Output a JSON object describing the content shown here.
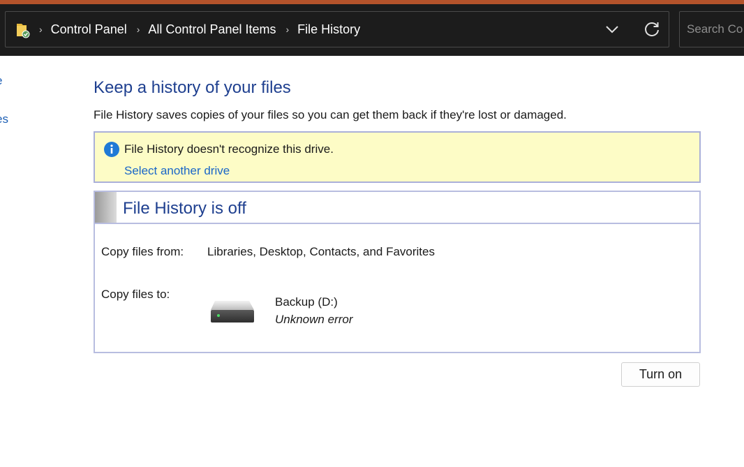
{
  "breadcrumb": {
    "items": [
      "Control Panel",
      "All Control Panel Items",
      "File History"
    ],
    "separator": "›"
  },
  "search": {
    "placeholder": "Search Co"
  },
  "sidebar": {
    "fragments": [
      "e",
      "es"
    ]
  },
  "main": {
    "title": "Keep a history of your files",
    "description": "File History saves copies of your files so you can get them back if they're lost or damaged.",
    "notice": {
      "text": "File History doesn't recognize this drive.",
      "link": "Select another drive"
    },
    "status": {
      "title": "File History is off",
      "copy_from_label": "Copy files from:",
      "copy_from_value": "Libraries, Desktop, Contacts, and Favorites",
      "copy_to_label": "Copy files to:",
      "drive_name": "Backup (D:)",
      "drive_status": "Unknown error"
    },
    "turn_on_button": "Turn on"
  },
  "colors": {
    "accent_strip": "#b4532b",
    "titlebar": "#1c1c1c",
    "heading_blue": "#1e3f8f",
    "link_blue": "#1a66c8",
    "notice_bg": "#fdfcc6"
  },
  "icons": [
    "folder-icon",
    "chevron-right-icon",
    "chevron-down-icon",
    "refresh-icon",
    "info-icon",
    "drive-icon"
  ]
}
